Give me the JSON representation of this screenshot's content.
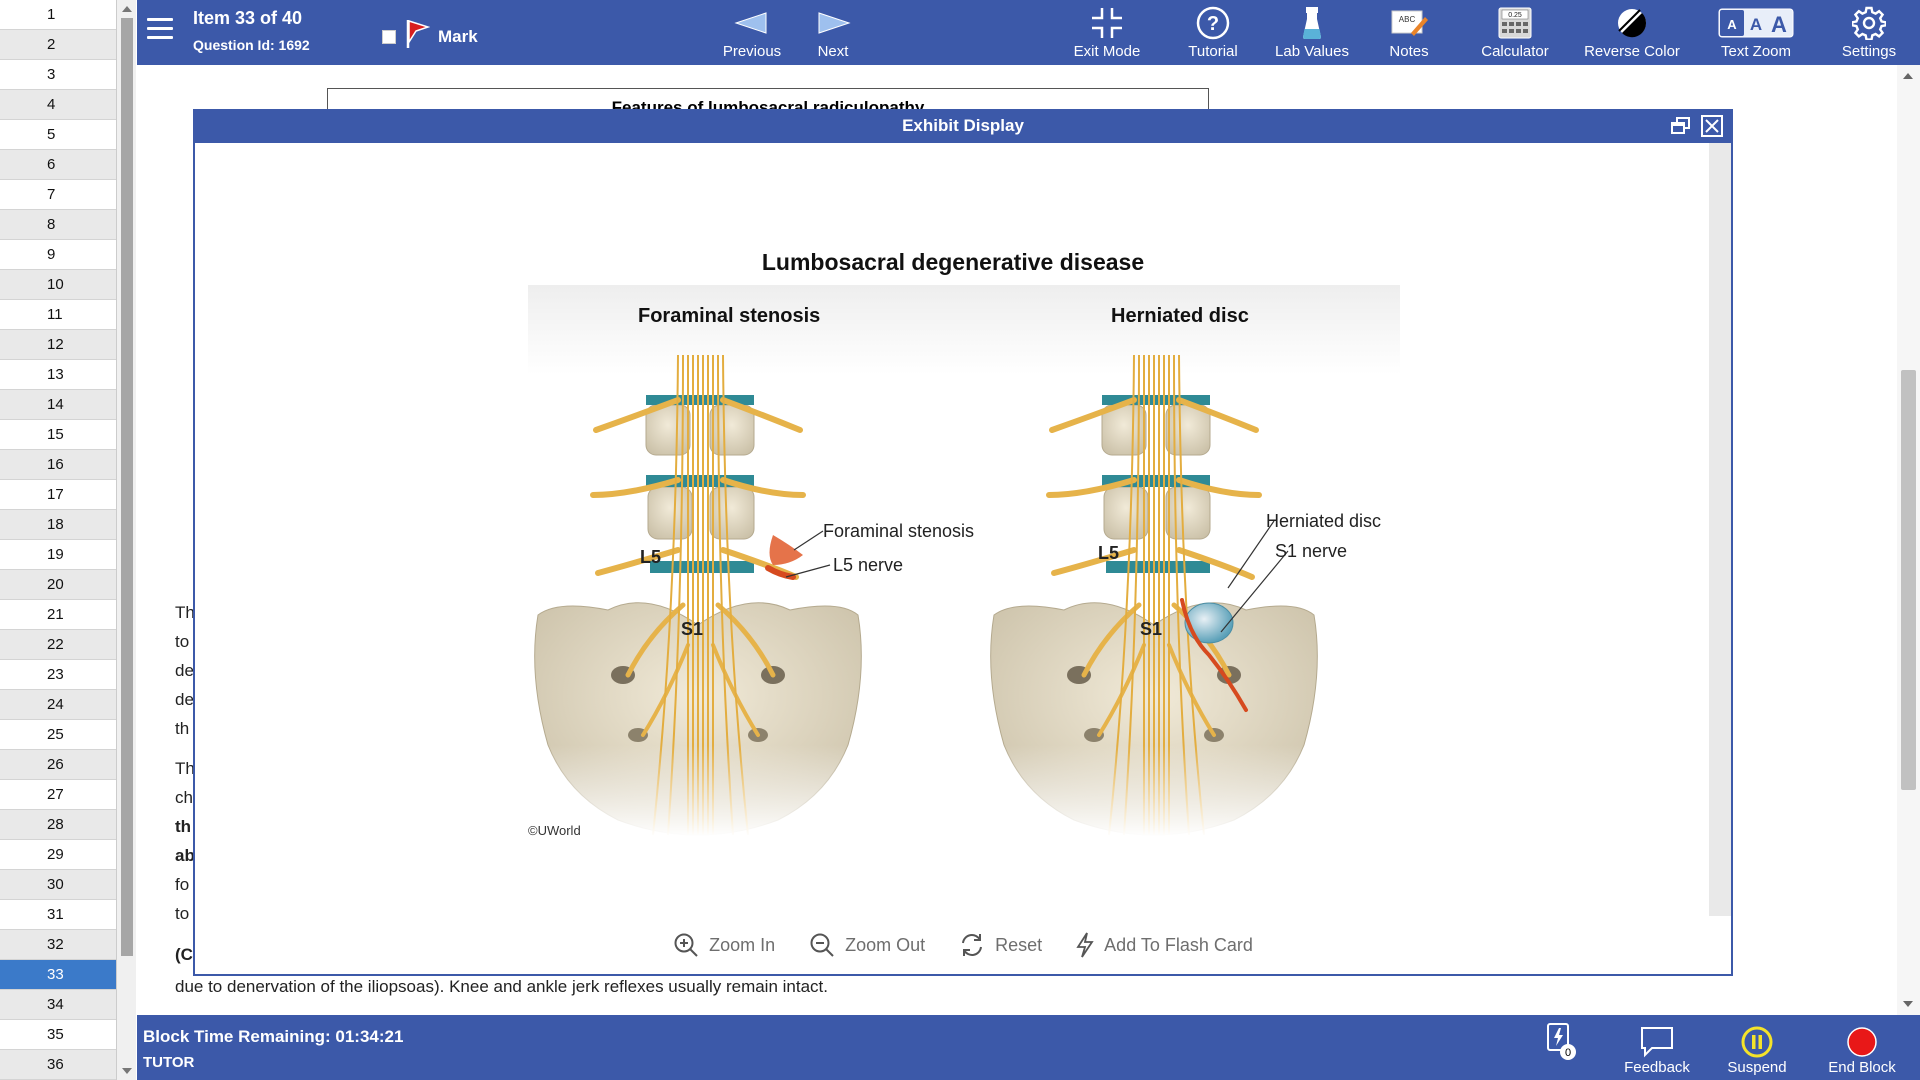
{
  "question_nav": {
    "items": [
      "1",
      "2",
      "3",
      "4",
      "5",
      "6",
      "7",
      "8",
      "9",
      "10",
      "11",
      "12",
      "13",
      "14",
      "15",
      "16",
      "17",
      "18",
      "19",
      "20",
      "21",
      "22",
      "23",
      "24",
      "25",
      "26",
      "27",
      "28",
      "29",
      "30",
      "31",
      "32",
      "33",
      "34",
      "35",
      "36"
    ],
    "current": "33"
  },
  "topbar": {
    "item_title": "Item 33 of 40",
    "question_id": "Question Id: 1692",
    "mark_label": "Mark",
    "previous_label": "Previous",
    "next_label": "Next",
    "exit_mode_label": "Exit Mode",
    "tutorial_label": "Tutorial",
    "lab_values_label": "Lab Values",
    "notes_label": "Notes",
    "calculator_label": "Calculator",
    "reverse_color_label": "Reverse Color",
    "text_zoom_label": "Text Zoom",
    "settings_label": "Settings",
    "calculator_display": "0.25",
    "notes_icon_text": "ABC"
  },
  "background": {
    "table_title": "Features of lumbosacral radiculopathy",
    "line_fragments": [
      "Th",
      "to",
      "de",
      "de",
      "th",
      "Th",
      "ch",
      "th",
      "ab",
      "fo",
      "to",
      "(C"
    ],
    "last_line": "due to denervation of the iliopsoas).  Knee and ankle jerk reflexes usually remain intact."
  },
  "modal": {
    "title": "Exhibit Display",
    "figure_title": "Lumbosacral degenerative disease",
    "left_panel_title": "Foraminal stenosis",
    "right_panel_title": "Herniated disc",
    "labels": {
      "left_l5": "L5",
      "left_s1": "S1",
      "left_callout_1": "Foraminal stenosis",
      "left_callout_2": "L5 nerve",
      "right_l5": "L5",
      "right_s1": "S1",
      "right_callout_1": "Herniated disc",
      "right_callout_2": "S1 nerve"
    },
    "copyright": "©UWorld",
    "toolbar": {
      "zoom_in": "Zoom In",
      "zoom_out": "Zoom Out",
      "reset": "Reset",
      "flash_card": "Add To Flash Card"
    }
  },
  "bottombar": {
    "time_remaining": "Block Time Remaining: 01:34:21",
    "mode": "TUTOR",
    "flashcard_count": "0",
    "feedback_label": "Feedback",
    "suspend_label": "Suspend",
    "end_block_label": "End Block"
  },
  "colors": {
    "header_blue": "#3c59a9",
    "nav_current": "#3b7ac9",
    "nerve_yellow": "#e6b34a",
    "bone": "#e8e0c8",
    "disc_teal": "#2f8a95",
    "nerve_red": "#d64a1f",
    "end_block_red": "#e81818",
    "suspend_yellow": "#f4e32a"
  }
}
